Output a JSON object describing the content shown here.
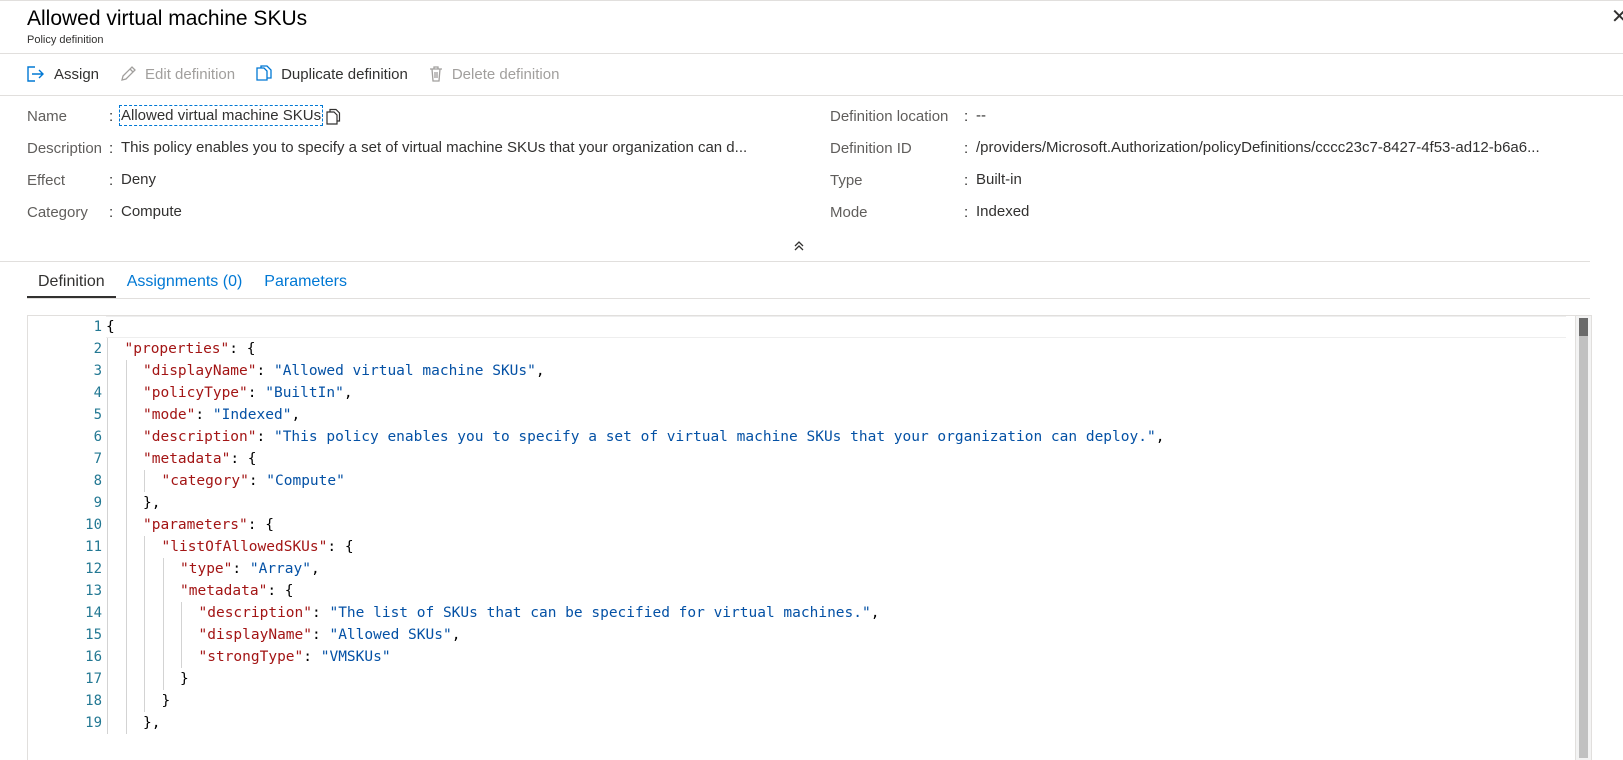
{
  "blade": {
    "title": "Allowed virtual machine SKUs",
    "subtitle": "Policy definition",
    "close_glyph": "✕"
  },
  "toolbar": {
    "assign_label": "Assign",
    "edit_label": "Edit definition",
    "duplicate_label": "Duplicate definition",
    "delete_label": "Delete definition"
  },
  "essentials": {
    "left": [
      {
        "label": "Name",
        "value": "Allowed virtual machine SKUs"
      },
      {
        "label": "Description",
        "value": "This policy enables you to specify a set of virtual machine SKUs that your organization can d..."
      },
      {
        "label": "Effect",
        "value": "Deny"
      },
      {
        "label": "Category",
        "value": "Compute"
      }
    ],
    "right": [
      {
        "label": "Definition location",
        "value": "--"
      },
      {
        "label": "Definition ID",
        "value": "/providers/Microsoft.Authorization/policyDefinitions/cccc23c7-8427-4f53-ad12-b6a6..."
      },
      {
        "label": "Type",
        "value": "Built-in"
      },
      {
        "label": "Mode",
        "value": "Indexed"
      }
    ],
    "separator": ":"
  },
  "tabs": [
    {
      "label": "Definition",
      "active": true
    },
    {
      "label": "Assignments (0)",
      "active": false
    },
    {
      "label": "Parameters",
      "active": false
    }
  ],
  "editor": {
    "line_numbers": [
      "1",
      "2",
      "3",
      "4",
      "5",
      "6",
      "7",
      "8",
      "9",
      "10",
      "11",
      "12",
      "13",
      "14",
      "15",
      "16",
      "17",
      "18",
      "19"
    ],
    "lines": [
      {
        "indent": 0,
        "tokens": [
          [
            "p",
            "{"
          ]
        ]
      },
      {
        "indent": 1,
        "tokens": [
          [
            "k",
            "\"properties\""
          ],
          [
            "p",
            ": {"
          ]
        ]
      },
      {
        "indent": 2,
        "tokens": [
          [
            "k",
            "\"displayName\""
          ],
          [
            "p",
            ": "
          ],
          [
            "s",
            "\"Allowed virtual machine SKUs\""
          ],
          [
            "p",
            ","
          ]
        ]
      },
      {
        "indent": 2,
        "tokens": [
          [
            "k",
            "\"policyType\""
          ],
          [
            "p",
            ": "
          ],
          [
            "s",
            "\"BuiltIn\""
          ],
          [
            "p",
            ","
          ]
        ]
      },
      {
        "indent": 2,
        "tokens": [
          [
            "k",
            "\"mode\""
          ],
          [
            "p",
            ": "
          ],
          [
            "s",
            "\"Indexed\""
          ],
          [
            "p",
            ","
          ]
        ]
      },
      {
        "indent": 2,
        "tokens": [
          [
            "k",
            "\"description\""
          ],
          [
            "p",
            ": "
          ],
          [
            "s",
            "\"This policy enables you to specify a set of virtual machine SKUs that your organization can deploy.\""
          ],
          [
            "p",
            ","
          ]
        ]
      },
      {
        "indent": 2,
        "tokens": [
          [
            "k",
            "\"metadata\""
          ],
          [
            "p",
            ": {"
          ]
        ]
      },
      {
        "indent": 3,
        "tokens": [
          [
            "k",
            "\"category\""
          ],
          [
            "p",
            ": "
          ],
          [
            "s",
            "\"Compute\""
          ]
        ]
      },
      {
        "indent": 2,
        "tokens": [
          [
            "p",
            "},"
          ]
        ]
      },
      {
        "indent": 2,
        "tokens": [
          [
            "k",
            "\"parameters\""
          ],
          [
            "p",
            ": {"
          ]
        ]
      },
      {
        "indent": 3,
        "tokens": [
          [
            "k",
            "\"listOfAllowedSKUs\""
          ],
          [
            "p",
            ": {"
          ]
        ]
      },
      {
        "indent": 4,
        "tokens": [
          [
            "k",
            "\"type\""
          ],
          [
            "p",
            ": "
          ],
          [
            "s",
            "\"Array\""
          ],
          [
            "p",
            ","
          ]
        ]
      },
      {
        "indent": 4,
        "tokens": [
          [
            "k",
            "\"metadata\""
          ],
          [
            "p",
            ": {"
          ]
        ]
      },
      {
        "indent": 5,
        "tokens": [
          [
            "k",
            "\"description\""
          ],
          [
            "p",
            ": "
          ],
          [
            "s",
            "\"The list of SKUs that can be specified for virtual machines.\""
          ],
          [
            "p",
            ","
          ]
        ]
      },
      {
        "indent": 5,
        "tokens": [
          [
            "k",
            "\"displayName\""
          ],
          [
            "p",
            ": "
          ],
          [
            "s",
            "\"Allowed SKUs\""
          ],
          [
            "p",
            ","
          ]
        ]
      },
      {
        "indent": 5,
        "tokens": [
          [
            "k",
            "\"strongType\""
          ],
          [
            "p",
            ": "
          ],
          [
            "s",
            "\"VMSKUs\""
          ]
        ]
      },
      {
        "indent": 4,
        "tokens": [
          [
            "p",
            "}"
          ]
        ]
      },
      {
        "indent": 3,
        "tokens": [
          [
            "p",
            "}"
          ]
        ]
      },
      {
        "indent": 2,
        "tokens": [
          [
            "p",
            "},"
          ]
        ]
      }
    ]
  },
  "colors": {
    "accent": "#0078d4",
    "json_key": "#a31515",
    "json_string": "#0451a5",
    "line_number": "#237893"
  }
}
